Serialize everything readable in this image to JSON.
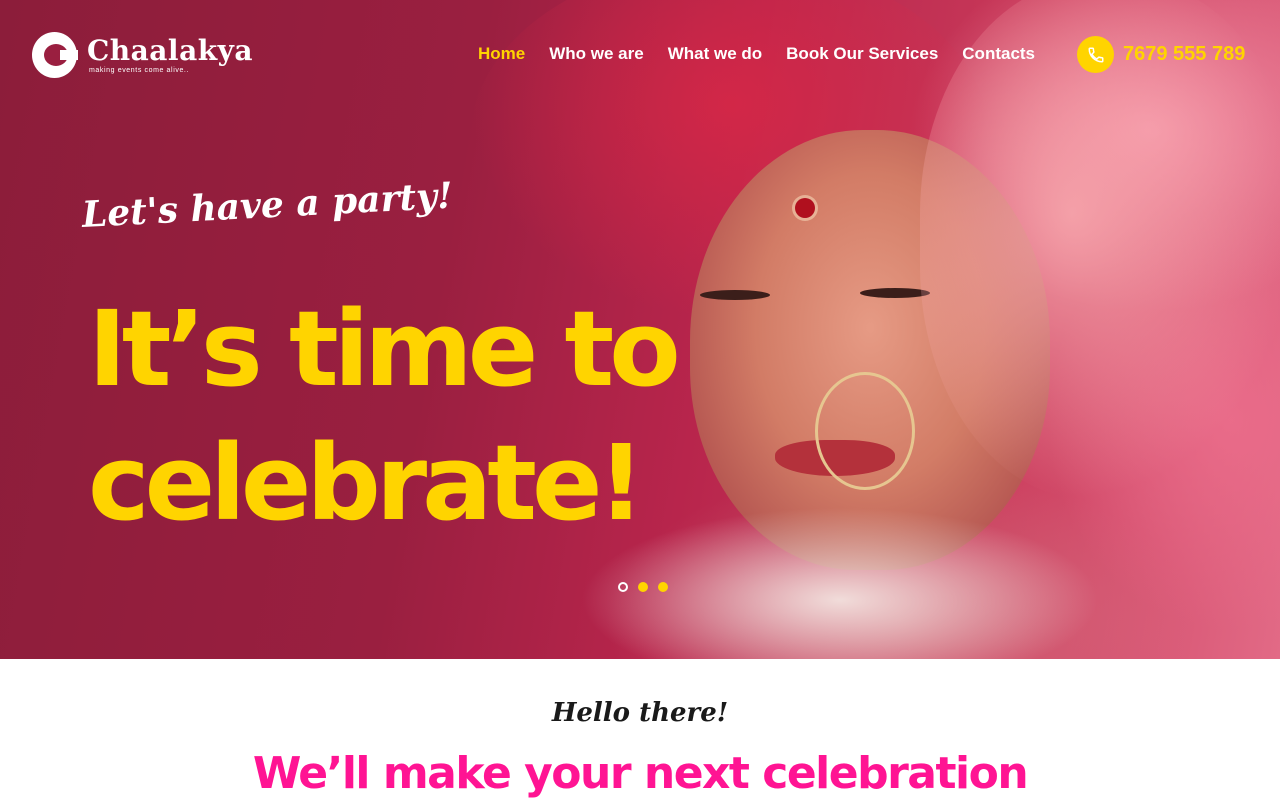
{
  "brand": {
    "name": "Chaalakya",
    "tagline": "making events come alive..",
    "logo_icon": "logo-c-icon"
  },
  "nav": {
    "items": [
      {
        "label": "Home",
        "active": true
      },
      {
        "label": "Who we are",
        "active": false
      },
      {
        "label": "What we do",
        "active": false
      },
      {
        "label": "Book Our Services",
        "active": false
      },
      {
        "label": "Contacts",
        "active": false
      }
    ]
  },
  "contact": {
    "phone": "7679 555 789",
    "icon": "phone-icon"
  },
  "hero": {
    "script_text": "Let's have a party!",
    "title_line1": "It’s time to",
    "title_line2": "celebrate!",
    "slides": {
      "count": 3,
      "active_index": 0
    }
  },
  "intro": {
    "script_text": "Hello there!",
    "heading": "We’ll make your next celebration"
  },
  "colors": {
    "accent_yellow": "#ffd400",
    "accent_pink": "#ff1493",
    "hero_crimson": "#9a1f40"
  }
}
